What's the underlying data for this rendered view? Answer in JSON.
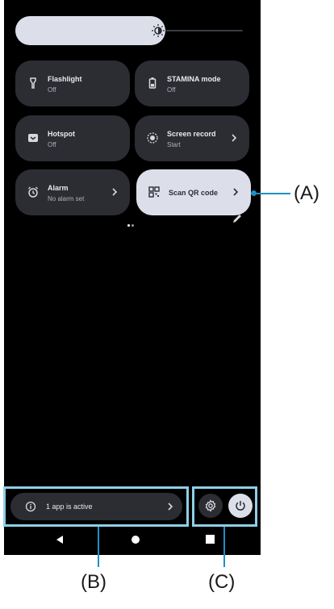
{
  "quick_settings": {
    "tiles": [
      {
        "title": "Flashlight",
        "subtitle": "Off"
      },
      {
        "title": "STAMINA mode",
        "subtitle": "Off"
      },
      {
        "title": "Hotspot",
        "subtitle": "Off"
      },
      {
        "title": "Screen record",
        "subtitle": "Start"
      },
      {
        "title": "Alarm",
        "subtitle": "No alarm set"
      },
      {
        "title": "Scan QR code"
      }
    ]
  },
  "active_apps": {
    "label": "1 app is active"
  },
  "callouts": {
    "a": "(A)",
    "b": "(B)",
    "c": "(C)"
  },
  "icons": {
    "brightness": "brightness-icon",
    "flashlight": "flashlight-icon",
    "stamina": "battery-icon",
    "hotspot": "hotspot-icon",
    "screen_record": "record-icon",
    "alarm": "alarm-clock-icon",
    "qr": "qr-code-icon",
    "edit": "pencil-icon",
    "info": "info-icon",
    "settings": "gear-icon",
    "power": "power-icon"
  },
  "colors": {
    "accent": "#1e8fc4",
    "highlight_box": "#8ecfe6",
    "active_tile": "#dcdfea",
    "tile": "#2b2d33"
  }
}
